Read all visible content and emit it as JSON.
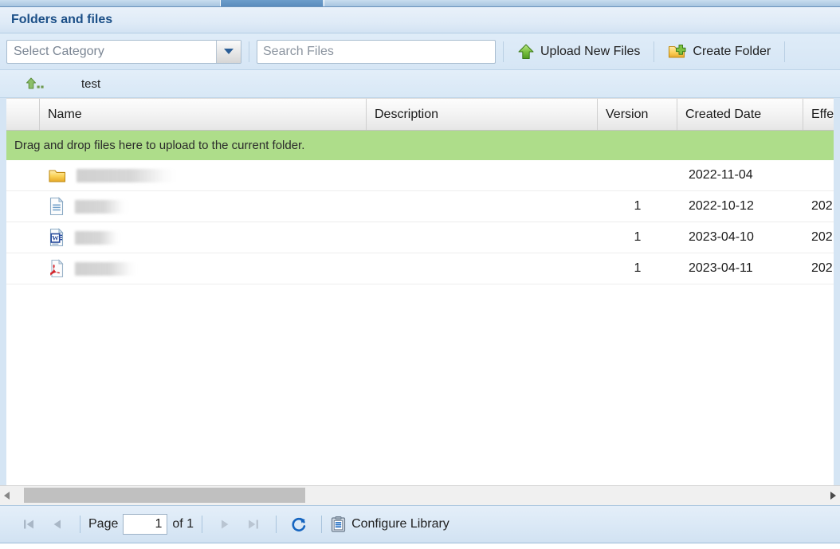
{
  "panel": {
    "title": "Folders and files"
  },
  "toolbar": {
    "category_selected": "Select Category",
    "category_icon": "chevron-down-icon",
    "search_placeholder": "Search Files",
    "search_value": "",
    "upload_label": "Upload New Files",
    "upload_icon": "green-up-arrow-icon",
    "create_folder_label": "Create Folder",
    "create_folder_icon": "folder-add-icon"
  },
  "breadcrumb": {
    "up_icon": "up-one-level-icon",
    "current_folder": "test"
  },
  "grid": {
    "columns": [
      {
        "key": "select",
        "label": ""
      },
      {
        "key": "name",
        "label": "Name"
      },
      {
        "key": "description",
        "label": "Description"
      },
      {
        "key": "version",
        "label": "Version"
      },
      {
        "key": "created",
        "label": "Created Date"
      },
      {
        "key": "effective",
        "label": "Effe"
      }
    ],
    "dropzone_text": "Drag and drop files here to upload to the current folder.",
    "rows": [
      {
        "icon": "folder-icon",
        "name": "",
        "name_redacted": true,
        "redacted_width": 125,
        "description": "",
        "version": "",
        "created": "2022-11-04",
        "effective": ""
      },
      {
        "icon": "text-document-icon",
        "name": "",
        "name_redacted": true,
        "redacted_width": 66,
        "description": "",
        "version": "1",
        "created": "2022-10-12",
        "effective": "202"
      },
      {
        "icon": "word-document-icon",
        "name": "",
        "name_redacted": true,
        "redacted_width": 57,
        "description": "",
        "version": "1",
        "created": "2023-04-10",
        "effective": "202"
      },
      {
        "icon": "pdf-document-icon",
        "name": "",
        "name_redacted": true,
        "redacted_width": 78,
        "description": "",
        "version": "1",
        "created": "2023-04-11",
        "effective": "202"
      }
    ]
  },
  "pager": {
    "first_icon": "first-page-icon",
    "prev_icon": "previous-page-icon",
    "next_icon": "next-page-icon",
    "last_icon": "last-page-icon",
    "page_label": "Page",
    "page_value": "1",
    "of_label": "of 1",
    "refresh_icon": "refresh-icon",
    "configure_icon": "configure-library-icon",
    "configure_label": "Configure Library"
  },
  "colors": {
    "panel_title_text": "#1b4f87",
    "dropzone_green": "#aedd8a",
    "accent_blue": "#2a5d96",
    "scrollbar_thumb": "#c0c0c0"
  }
}
